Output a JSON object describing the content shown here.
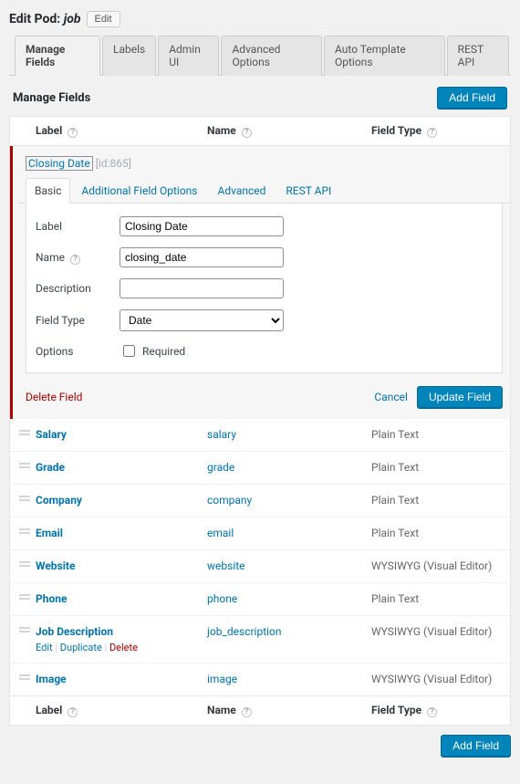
{
  "page": {
    "title_prefix": "Edit Pod:",
    "title_name": "job",
    "edit_btn": "Edit"
  },
  "tabs": {
    "items": [
      {
        "label": "Manage Fields",
        "active": true
      },
      {
        "label": "Labels",
        "active": false
      },
      {
        "label": "Admin UI",
        "active": false
      },
      {
        "label": "Advanced Options",
        "active": false
      },
      {
        "label": "Auto Template Options",
        "active": false
      },
      {
        "label": "REST API",
        "active": false
      }
    ]
  },
  "section": {
    "heading": "Manage Fields",
    "add_field_btn": "Add Field"
  },
  "columns": {
    "label": "Label",
    "name": "Name",
    "type": "Field Type"
  },
  "help_glyph": "?",
  "editor": {
    "field_label": "Closing Date",
    "id_prefix": "[id:",
    "id_value": "865",
    "id_suffix": "]",
    "inner_tabs": [
      {
        "label": "Basic",
        "active": true
      },
      {
        "label": "Additional Field Options",
        "active": false
      },
      {
        "label": "Advanced",
        "active": false
      },
      {
        "label": "REST API",
        "active": false
      }
    ],
    "form": {
      "label_label": "Label",
      "label_value": "Closing Date",
      "name_label": "Name",
      "name_value": "closing_date",
      "desc_label": "Description",
      "desc_value": "",
      "type_label": "Field Type",
      "type_value": "Date",
      "options_label": "Options",
      "required_label": "Required"
    },
    "actions": {
      "delete": "Delete Field",
      "cancel": "Cancel",
      "update": "Update Field"
    }
  },
  "fields": [
    {
      "label": "Salary",
      "name": "salary",
      "type": "Plain Text"
    },
    {
      "label": "Grade",
      "name": "grade",
      "type": "Plain Text"
    },
    {
      "label": "Company",
      "name": "company",
      "type": "Plain Text"
    },
    {
      "label": "Email",
      "name": "email",
      "type": "Plain Text"
    },
    {
      "label": "Website",
      "name": "website",
      "type": "WYSIWYG (Visual Editor)"
    },
    {
      "label": "Phone",
      "name": "phone",
      "type": "Plain Text"
    },
    {
      "label": "Job Description",
      "name": "job_description",
      "type": "WYSIWYG (Visual Editor)",
      "hover": true
    },
    {
      "label": "Image",
      "name": "image",
      "type": "WYSIWYG (Visual Editor)"
    }
  ],
  "row_actions": {
    "edit": "Edit",
    "duplicate": "Duplicate",
    "delete": "Delete"
  }
}
